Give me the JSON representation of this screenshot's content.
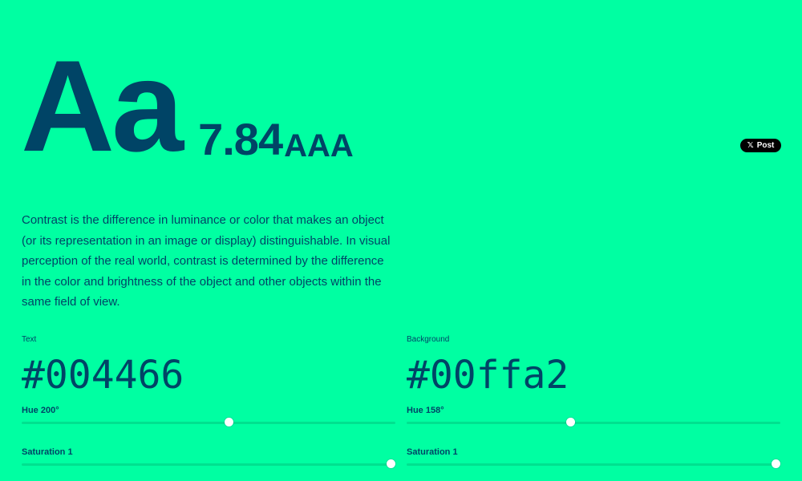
{
  "hero": {
    "sample": "Aa",
    "ratio": "7.84",
    "score": "AAA"
  },
  "share": {
    "icon": "x-icon",
    "label": "Post"
  },
  "description": "Contrast is the difference in luminance or color that makes an object (or its representation in an image or display) distinguishable. In visual perception of the real world, contrast is determined by the difference in the color and brightness of the object and other objects within the same field of view.",
  "text_color": {
    "label": "Text",
    "hex": "#004466",
    "hue_label": "Hue 200°",
    "hue_value": 200,
    "hue_max": 360,
    "saturation_label": "Saturation 1",
    "saturation_value": 1,
    "saturation_max": 1
  },
  "background_color": {
    "label": "Background",
    "hex": "#00ffa2",
    "hue_label": "Hue 158°",
    "hue_value": 158,
    "hue_max": 360,
    "saturation_label": "Saturation 1",
    "saturation_value": 1,
    "saturation_max": 1
  },
  "colors": {
    "text": "#004466",
    "background": "#00ffa2",
    "track": "#00e18f",
    "thumb": "#ffffff"
  }
}
